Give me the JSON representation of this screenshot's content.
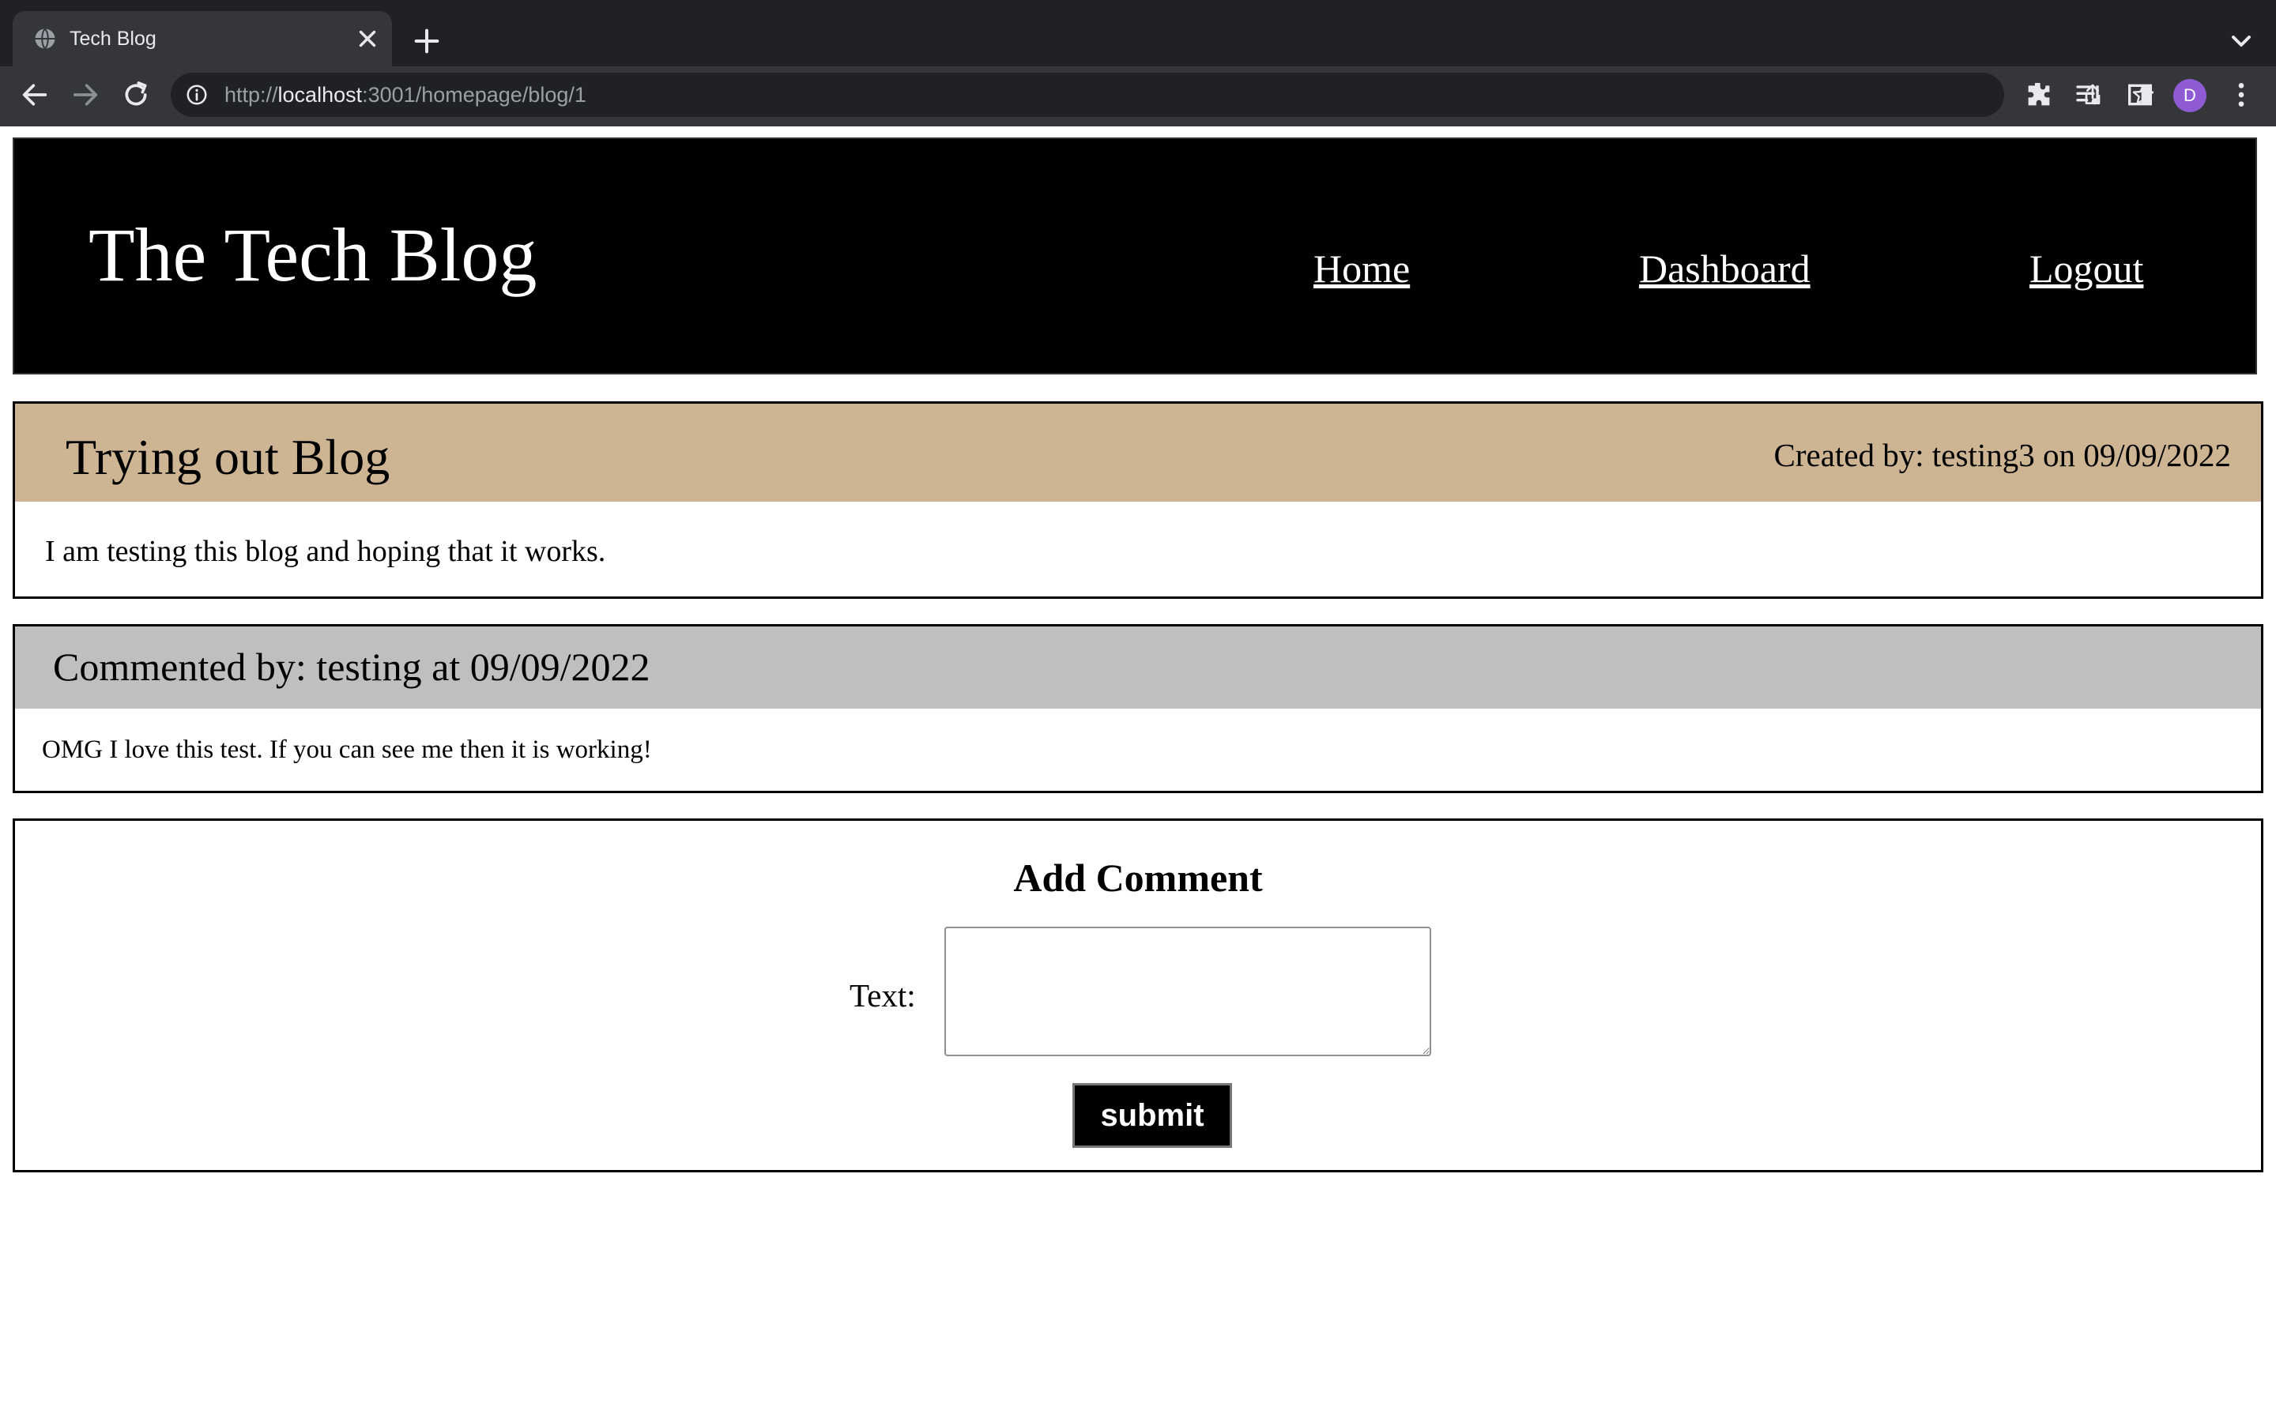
{
  "browser": {
    "tab": {
      "title": "Tech Blog",
      "favicon": "globe-icon"
    },
    "url": {
      "scheme": "http://",
      "host": "localhost",
      "rest": ":3001/homepage/blog/1"
    },
    "profile_initial": "D",
    "profile_color": "#8e5bd4",
    "icons": [
      "back-icon",
      "forward-icon",
      "reload-icon",
      "info-icon",
      "share-icon",
      "star-icon",
      "extensions-icon",
      "media-icon",
      "side-panel-icon",
      "more-icon"
    ]
  },
  "header": {
    "title": "The Tech Blog",
    "nav": {
      "home": "Home",
      "dashboard": "Dashboard",
      "logout": "Logout"
    }
  },
  "post": {
    "title": "Trying out Blog",
    "meta": "Created by: testing3 on 09/09/2022",
    "body": "I am testing this blog and hoping that it works."
  },
  "comment": {
    "author_line": "Commented by: testing at 09/09/2022",
    "body": "OMG I love this test. If you can see me then it is working!"
  },
  "add_comment": {
    "heading": "Add Comment",
    "text_label": "Text:",
    "text_value": "",
    "submit_label": "submit"
  },
  "colors": {
    "header_bg": "#000000",
    "post_head_bg": "#cdb493",
    "comment_head_bg": "#bfbfbf",
    "submit_bg": "#000000"
  }
}
